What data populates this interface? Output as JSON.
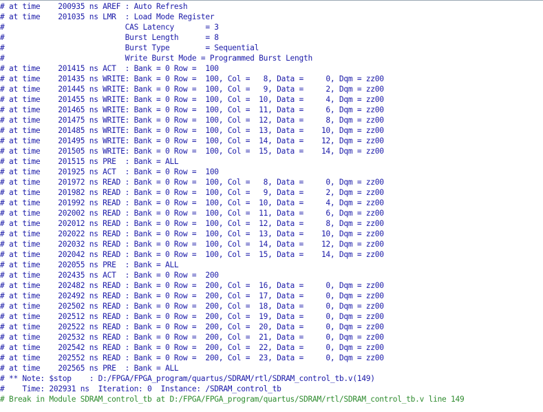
{
  "colors": {
    "log_text": "#1a1aa8",
    "break_text": "#2e8b2e",
    "background": "#ffffff"
  },
  "transcript": {
    "lines": [
      "# at time    200935 ns AREF : Auto Refresh",
      "# at time    201035 ns LMR  : Load Mode Register",
      "#                           CAS Latency       = 3",
      "#                           Burst Length      = 8",
      "#                           Burst Type        = Sequential",
      "#                           Write Burst Mode = Programmed Burst Length",
      "# at time    201415 ns ACT  : Bank = 0 Row =  100",
      "# at time    201435 ns WRITE: Bank = 0 Row =  100, Col =   8, Data =     0, Dqm = zz00",
      "# at time    201445 ns WRITE: Bank = 0 Row =  100, Col =   9, Data =     2, Dqm = zz00",
      "# at time    201455 ns WRITE: Bank = 0 Row =  100, Col =  10, Data =     4, Dqm = zz00",
      "# at time    201465 ns WRITE: Bank = 0 Row =  100, Col =  11, Data =     6, Dqm = zz00",
      "# at time    201475 ns WRITE: Bank = 0 Row =  100, Col =  12, Data =     8, Dqm = zz00",
      "# at time    201485 ns WRITE: Bank = 0 Row =  100, Col =  13, Data =    10, Dqm = zz00",
      "# at time    201495 ns WRITE: Bank = 0 Row =  100, Col =  14, Data =    12, Dqm = zz00",
      "# at time    201505 ns WRITE: Bank = 0 Row =  100, Col =  15, Data =    14, Dqm = zz00",
      "# at time    201515 ns PRE  : Bank = ALL",
      "# at time    201925 ns ACT  : Bank = 0 Row =  100",
      "# at time    201972 ns READ : Bank = 0 Row =  100, Col =   8, Data =     0, Dqm = zz00",
      "# at time    201982 ns READ : Bank = 0 Row =  100, Col =   9, Data =     2, Dqm = zz00",
      "# at time    201992 ns READ : Bank = 0 Row =  100, Col =  10, Data =     4, Dqm = zz00",
      "# at time    202002 ns READ : Bank = 0 Row =  100, Col =  11, Data =     6, Dqm = zz00",
      "# at time    202012 ns READ : Bank = 0 Row =  100, Col =  12, Data =     8, Dqm = zz00",
      "# at time    202022 ns READ : Bank = 0 Row =  100, Col =  13, Data =    10, Dqm = zz00",
      "# at time    202032 ns READ : Bank = 0 Row =  100, Col =  14, Data =    12, Dqm = zz00",
      "# at time    202042 ns READ : Bank = 0 Row =  100, Col =  15, Data =    14, Dqm = zz00",
      "# at time    202055 ns PRE  : Bank = ALL",
      "# at time    202435 ns ACT  : Bank = 0 Row =  200",
      "# at time    202482 ns READ : Bank = 0 Row =  200, Col =  16, Data =     0, Dqm = zz00",
      "# at time    202492 ns READ : Bank = 0 Row =  200, Col =  17, Data =     0, Dqm = zz00",
      "# at time    202502 ns READ : Bank = 0 Row =  200, Col =  18, Data =     0, Dqm = zz00",
      "# at time    202512 ns READ : Bank = 0 Row =  200, Col =  19, Data =     0, Dqm = zz00",
      "# at time    202522 ns READ : Bank = 0 Row =  200, Col =  20, Data =     0, Dqm = zz00",
      "# at time    202532 ns READ : Bank = 0 Row =  200, Col =  21, Data =     0, Dqm = zz00",
      "# at time    202542 ns READ : Bank = 0 Row =  200, Col =  22, Data =     0, Dqm = zz00",
      "# at time    202552 ns READ : Bank = 0 Row =  200, Col =  23, Data =     0, Dqm = zz00",
      "# at time    202565 ns PRE  : Bank = ALL",
      "# ** Note: $stop    : D:/FPGA/FPGA_program/quartus/SDRAM/rtl/SDRAM_control_tb.v(149)",
      "#    Time: 202931 ns  Iteration: 0  Instance: /SDRAM_control_tb"
    ],
    "break_line": "# Break in Module SDRAM_control_tb at D:/FPGA/FPGA_program/quartus/SDRAM/rtl/SDRAM_control_tb.v line 149"
  }
}
